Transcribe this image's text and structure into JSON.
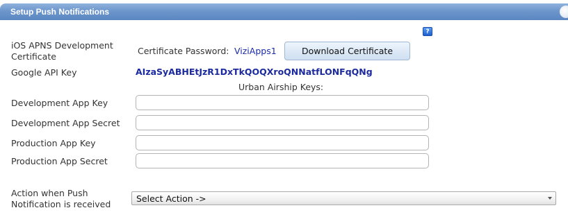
{
  "panel": {
    "title": "Setup Push Notifications"
  },
  "help_icon": "?",
  "ios": {
    "label_line1": "iOS APNS Development",
    "label_line2": "Certificate",
    "password_label": "Certificate Password:",
    "password_value": "ViziApps1",
    "download_button": "Download Certificate"
  },
  "google": {
    "label": "Google API Key",
    "value": "AIzaSyABHEtJzR1DxTkQOQXroQNNatfLONFqQNg"
  },
  "urban_airship": {
    "title": "Urban Airship Keys:",
    "fields": [
      {
        "label": "Development App Key",
        "value": ""
      },
      {
        "label": "Development App Secret",
        "value": ""
      },
      {
        "label": "Production App Key",
        "value": ""
      },
      {
        "label": "Production App Secret",
        "value": ""
      }
    ]
  },
  "action": {
    "label_line1": "Action when Push",
    "label_line2": "Notification is received",
    "selected": "Select Action ->"
  },
  "colors": {
    "header": "#6d96cc",
    "link_text": "#1b2a9e",
    "button_border": "#9fb7d4"
  }
}
